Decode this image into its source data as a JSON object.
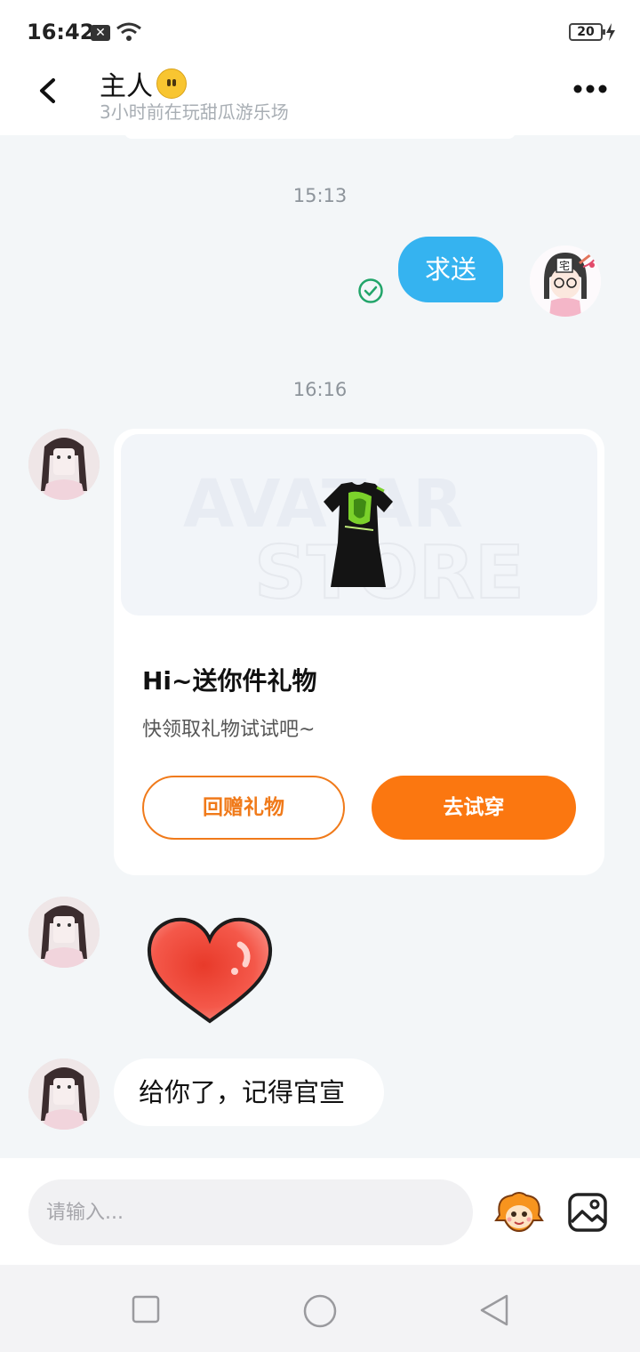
{
  "status_bar": {
    "time": "16:42",
    "battery": "20",
    "notification_icon": "x-icon",
    "wifi_icon": "wifi-icon"
  },
  "header": {
    "title": "主人",
    "title_emoji": "neutral-face-emoji",
    "subtitle": "3小时前在玩甜瓜游乐场"
  },
  "messages": {
    "timestamp_1": "15:13",
    "sent_text": "求送",
    "timestamp_2": "16:16",
    "gift_card": {
      "title": "Hi~送你件礼物",
      "description": "快领取礼物试试吧~",
      "return_gift_button": "回赠礼物",
      "try_on_button": "去试穿",
      "watermark_line1": "AVATAR",
      "watermark_line2": "STORE"
    },
    "sticker": "heart-sticker",
    "received_text": "给你了，记得官宣"
  },
  "input": {
    "placeholder": "请输入..."
  },
  "colors": {
    "accent_orange": "#fb7710",
    "sent_bubble": "#35b3f0",
    "read_check": "#22a56a",
    "background": "#f3f6f8"
  }
}
